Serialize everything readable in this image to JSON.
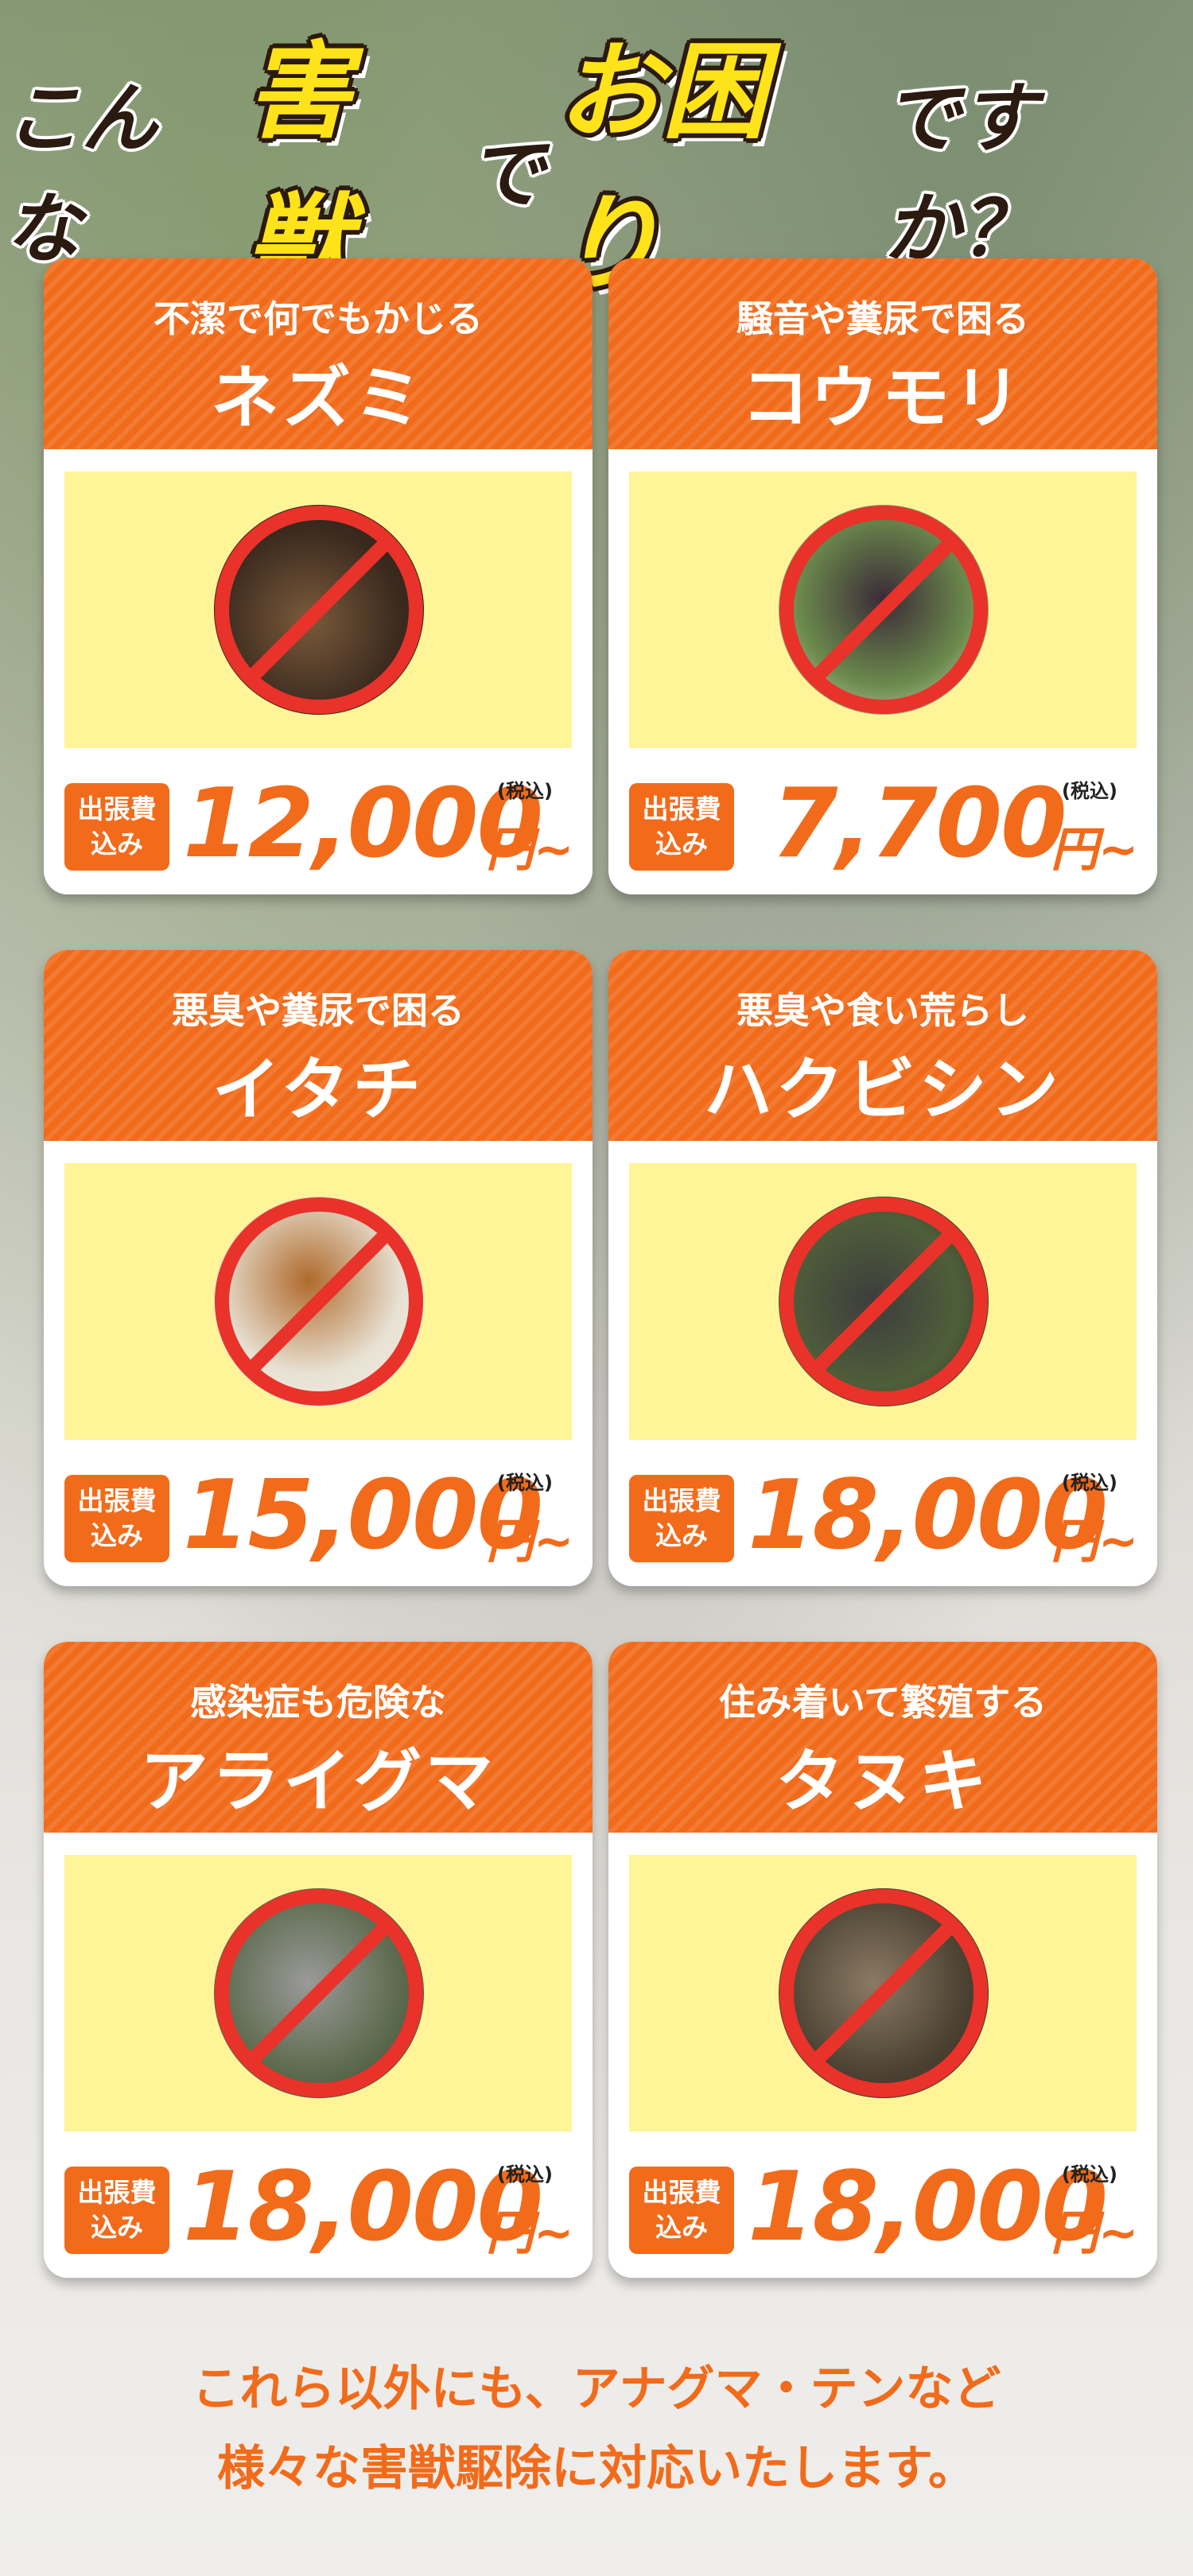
{
  "header": {
    "part1": "こんな",
    "part2": "害獣",
    "part3": "で",
    "part4": "お困り",
    "part5": "ですか？"
  },
  "cards": [
    {
      "subtitle": "不潔で何でもかじる",
      "name": "ネズミ",
      "badge_line1": "出張費",
      "badge_line2": "込み",
      "price": "12,000",
      "price_unit": "円~",
      "tax_note": "(税込)",
      "photo_icon": "rat-photo"
    },
    {
      "subtitle": "騒音や糞尿で困る",
      "name": "コウモリ",
      "badge_line1": "出張費",
      "badge_line2": "込み",
      "price": "7,700",
      "price_unit": "円~",
      "tax_note": "(税込)",
      "photo_icon": "bat-photo"
    },
    {
      "subtitle": "悪臭や糞尿で困る",
      "name": "イタチ",
      "badge_line1": "出張費",
      "badge_line2": "込み",
      "price": "15,000",
      "price_unit": "円~",
      "tax_note": "(税込)",
      "photo_icon": "weasel-photo"
    },
    {
      "subtitle": "悪臭や食い荒らし",
      "name": "ハクビシン",
      "badge_line1": "出張費",
      "badge_line2": "込み",
      "price": "18,000",
      "price_unit": "円~",
      "tax_note": "(税込)",
      "photo_icon": "civet-photo"
    },
    {
      "subtitle": "感染症も危険な",
      "name": "アライグマ",
      "badge_line1": "出張費",
      "badge_line2": "込み",
      "price": "18,000",
      "price_unit": "円~",
      "tax_note": "(税込)",
      "photo_icon": "raccoon-photo"
    },
    {
      "subtitle": "住み着いて繁殖する",
      "name": "タヌキ",
      "badge_line1": "出張費",
      "badge_line2": "込み",
      "price": "18,000",
      "price_unit": "円~",
      "tax_note": "(税込)",
      "photo_icon": "raccoon-dog-photo"
    }
  ],
  "footer": {
    "line1": "これら以外にも、アナグマ・テンなど",
    "line2": "様々な害獣駆除に対応いたします。"
  },
  "colors": {
    "accent": "#f16b1b",
    "photo_bg": "#fff498",
    "heading_highlight": "#ffe31a",
    "prohibit_red": "#e8322a"
  }
}
